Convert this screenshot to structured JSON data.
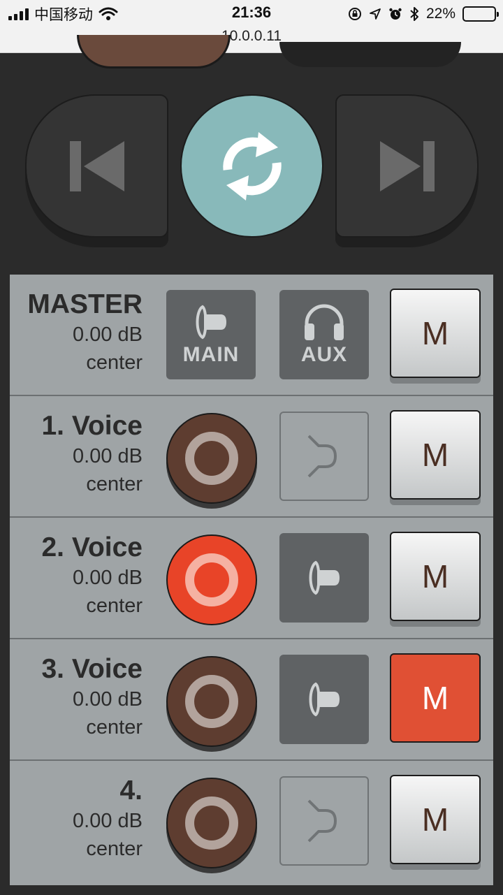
{
  "status_bar": {
    "carrier": "中国移动",
    "time": "21:36",
    "url": "10.0.0.11",
    "battery": "22%",
    "battery_level": 0.22
  },
  "transport": {
    "prev_icon": "skip-previous-icon",
    "sync_icon": "sync-icon",
    "next_icon": "skip-next-icon"
  },
  "master": {
    "name": "MASTER",
    "level": "0.00 dB",
    "pan": "center",
    "main_label": "MAIN",
    "aux_label": "AUX",
    "mute_label": "M",
    "muted": false
  },
  "channels": [
    {
      "name": "1. Voice",
      "level": "0.00 dB",
      "pan": "center",
      "record_active": false,
      "routing": "split-icon",
      "mute_label": "M",
      "muted": false
    },
    {
      "name": "2. Voice",
      "level": "0.00 dB",
      "pan": "center",
      "record_active": true,
      "routing": "speaker-icon",
      "mute_label": "M",
      "muted": false
    },
    {
      "name": "3. Voice",
      "level": "0.00 dB",
      "pan": "center",
      "record_active": false,
      "routing": "speaker-icon",
      "mute_label": "M",
      "muted": true
    },
    {
      "name": "4.",
      "level": "0.00 dB",
      "pan": "center",
      "record_active": false,
      "routing": "split-icon",
      "mute_label": "M",
      "muted": false
    }
  ],
  "colors": {
    "accent_teal": "#88b9ba",
    "record_active": "#e84428",
    "mute_active": "#e05034",
    "record_idle": "#5e3d30"
  }
}
